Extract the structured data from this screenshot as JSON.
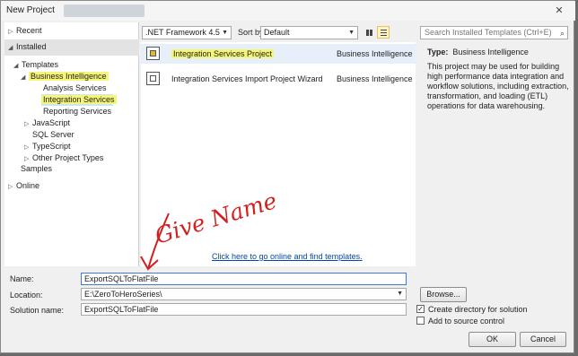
{
  "window": {
    "title": "New Project",
    "close": "✕"
  },
  "tree": {
    "recent": "Recent",
    "installed": "Installed",
    "templates": "Templates",
    "business_intelligence": "Business Intelligence",
    "analysis_services": "Analysis Services",
    "integration_services": "Integration Services",
    "reporting_services": "Reporting Services",
    "javascript": "JavaScript",
    "sql_server": "SQL Server",
    "typescript": "TypeScript",
    "other_project_types": "Other Project Types",
    "samples": "Samples",
    "online": "Online"
  },
  "toolbar": {
    "framework": ".NET Framework 4.5",
    "sort_label": "Sort by:",
    "sort_value": "Default",
    "search_placeholder": "Search Installed Templates (Ctrl+E)"
  },
  "templates": [
    {
      "name": "Integration Services Project",
      "type": "Business Intelligence"
    },
    {
      "name": "Integration Services Import Project Wizard",
      "type": "Business Intelligence"
    }
  ],
  "online_link": "Click here to go online and find templates.",
  "info": {
    "type_label": "Type:",
    "type_value": "Business Intelligence",
    "description": "This project may be used for building high performance data integration and workflow solutions, including extraction, transformation, and loading (ETL) operations for data warehousing."
  },
  "form": {
    "name_label": "Name:",
    "name_value": "ExportSQLToFlatFile",
    "location_label": "Location:",
    "location_value": "E:\\ZeroToHeroSeries\\",
    "solution_label": "Solution name:",
    "solution_value": "ExportSQLToFlatFile",
    "browse": "Browse...",
    "create_dir": "Create directory for solution",
    "add_source": "Add to source control",
    "create_dir_checked": true,
    "add_source_checked": false,
    "ok": "OK",
    "cancel": "Cancel"
  },
  "annotation": {
    "text": "Give Name",
    "color": "#d21f1f"
  },
  "colors": {
    "highlight": "#f5f57a",
    "selection": "#cce4f7",
    "link": "#0645ad"
  }
}
